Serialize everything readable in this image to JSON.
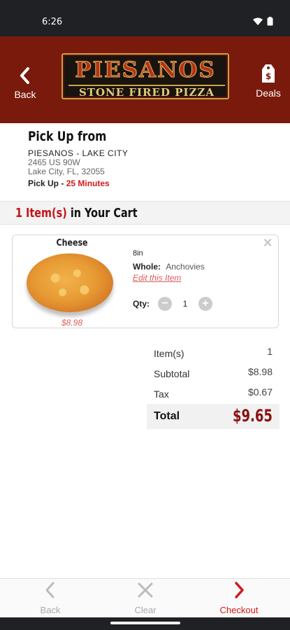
{
  "status_bar": {
    "time": "6:26"
  },
  "header": {
    "back_label": "Back",
    "deals_label": "Deals",
    "logo": {
      "line1": "PIESANOS",
      "line2": "STONE FIRED PIZZA"
    }
  },
  "pickup": {
    "title": "Pick Up from",
    "store_name": "PIESANOS - LAKE CITY",
    "address_line1": "2465 US 90W",
    "address_line2": "Lake City, FL, 32055",
    "time_label": "Pick Up -",
    "time_value": "25 Minutes"
  },
  "cart": {
    "count_text": "1 Item(s)",
    "title_text": "in Your Cart",
    "items": [
      {
        "name": "Cheese",
        "price": "$8.98",
        "size": "8in",
        "whole_label": "Whole:",
        "whole_value": "Anchovies",
        "edit_label": "Edit this Item",
        "qty_label": "Qty:",
        "qty_value": "1",
        "minus": "−",
        "plus": "+",
        "remove": "✕"
      }
    ]
  },
  "summary": {
    "items_label": "Item(s)",
    "items_value": "1",
    "subtotal_label": "Subtotal",
    "subtotal_value": "$8.98",
    "tax_label": "Tax",
    "tax_value": "$0.67",
    "total_label": "Total",
    "total_value": "$9.65"
  },
  "bottom_nav": {
    "back_label": "Back",
    "clear_label": "Clear",
    "checkout_label": "Checkout"
  },
  "colors": {
    "header_bg": "#7a1a0c",
    "accent_red": "#d11a1a",
    "total_red": "#8a1212"
  }
}
